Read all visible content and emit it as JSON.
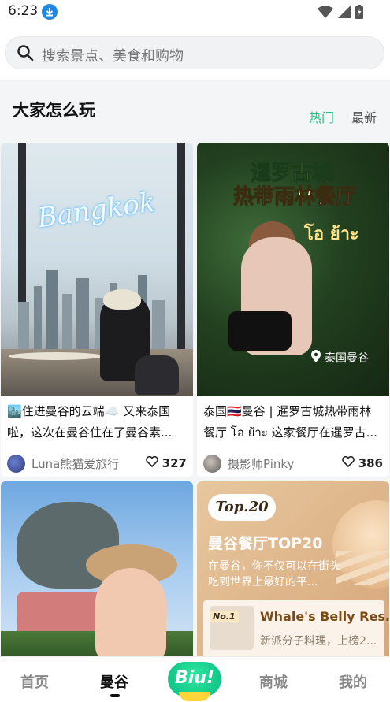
{
  "status_bar": {
    "time": "6:23"
  },
  "search": {
    "placeholder": "搜索景点、美食和购物"
  },
  "section": {
    "title": "大家怎么玩",
    "tabs": [
      {
        "label": "热门",
        "active": true,
        "color": "#26c281"
      },
      {
        "label": "最新",
        "active": false
      }
    ]
  },
  "cards": [
    {
      "image_text": "Bangkok",
      "title": "🏙️住进曼谷的云端☁️ 又来泰国啦，这次在曼谷住在了曼谷素...",
      "author": "Luna熊猫爱旅行",
      "likes": "327"
    },
    {
      "image_title_line1": "暹罗古城",
      "image_title_line2": "热带雨林餐厅",
      "image_thai": "โอ ย้าะ",
      "image_location": "泰国曼谷",
      "title": "泰国🇹🇭曼谷 | 暹罗古城热带雨林餐厅 โอ ย้าะ 这家餐厅在暹罗古...",
      "author": "摄影师Pinky",
      "likes": "386"
    },
    {
      "image_desc": "elephant statue and woman in straw hat"
    },
    {
      "badge": "Top.20",
      "promo_title": "曼谷餐厅TOP20",
      "promo_subtitle": "在曼谷，你不仅可以在街头吃到世界上最好的平...",
      "rank_label": "No.1",
      "item_title": "Whale's Belly Res...",
      "item_subtitle": "新派分子料理，上榜2..."
    }
  ],
  "bottom_nav": {
    "items": [
      {
        "label": "首页",
        "active": false
      },
      {
        "label": "曼谷",
        "active": true
      },
      {
        "label": "Biu!",
        "center": true
      },
      {
        "label": "商城",
        "active": false
      },
      {
        "label": "我的",
        "active": false
      }
    ],
    "accent": "#13c98a"
  }
}
